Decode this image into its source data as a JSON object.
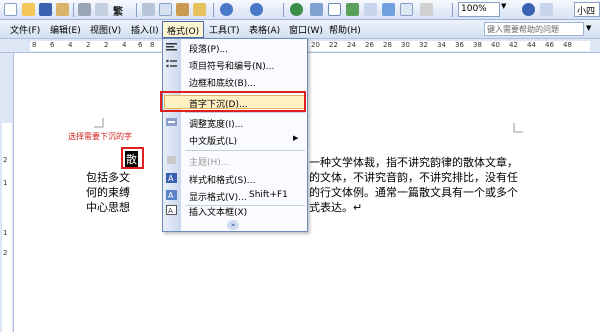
{
  "toolbar": {
    "style_symbol": "繁",
    "zoom": "100%",
    "font_partial": "小四"
  },
  "menubar": {
    "items": [
      "文件(F)",
      "编辑(E)",
      "视图(V)",
      "插入(I)",
      "格式(O)",
      "工具(T)",
      "表格(A)",
      "窗口(W)",
      "帮助(H)"
    ],
    "help_placeholder": "键入需要帮助的问题"
  },
  "ruler": {
    "h_numbers": [
      "8",
      "6",
      "4",
      "2",
      "2",
      "4",
      "6",
      "8",
      "10",
      "12",
      "20",
      "22",
      "24",
      "26",
      "28",
      "30",
      "32",
      "34",
      "36",
      "38",
      "40",
      "42",
      "44",
      "46",
      "48"
    ],
    "v_numbers": [
      "2",
      "1",
      "1",
      "2"
    ]
  },
  "format_menu": {
    "items": [
      {
        "label": "段落(P)...",
        "icon": "paragraph-icon"
      },
      {
        "label": "项目符号和编号(N)...",
        "icon": "bullets-icon"
      },
      {
        "label": "边框和底纹(B)...",
        "icon": ""
      },
      {
        "label": "首字下沉(D)...",
        "icon": "",
        "highlighted": true
      },
      {
        "label": "调整宽度(I)...",
        "icon": "adjust-width-icon"
      },
      {
        "label": "中文版式(L)",
        "icon": "",
        "submenu": true
      },
      {
        "label": "主题(H)...",
        "icon": "theme-icon",
        "disabled": true
      },
      {
        "label": "样式和格式(S)...",
        "icon": "styles-icon"
      },
      {
        "label": "显示格式(V)...",
        "icon": "reveal-format-icon",
        "shortcut": "Shift+F1"
      },
      {
        "label": "插入文本框(X)",
        "icon": "textbox-icon"
      }
    ],
    "expand_symbol": "»"
  },
  "document": {
    "annotation": "选择需要下沉的字",
    "drop_char": "散",
    "line1_tail": "一种文学体裁，指不讲究韵律的散体文章，",
    "line2_start": "包括多文",
    "line2_tail": "的文体，不讲究音韵，不讲究排比，没有任",
    "line3_start": "何的束缚",
    "line3_tail": "的行文体例。通常一篇散文具有一个或多个",
    "line4_start": "中心思想",
    "line4_tail": "式表达。↵"
  },
  "colors": {
    "highlight_red": "#e02020",
    "menu_hover": "#fff1c4",
    "chrome_blue": "#d3dff2"
  }
}
